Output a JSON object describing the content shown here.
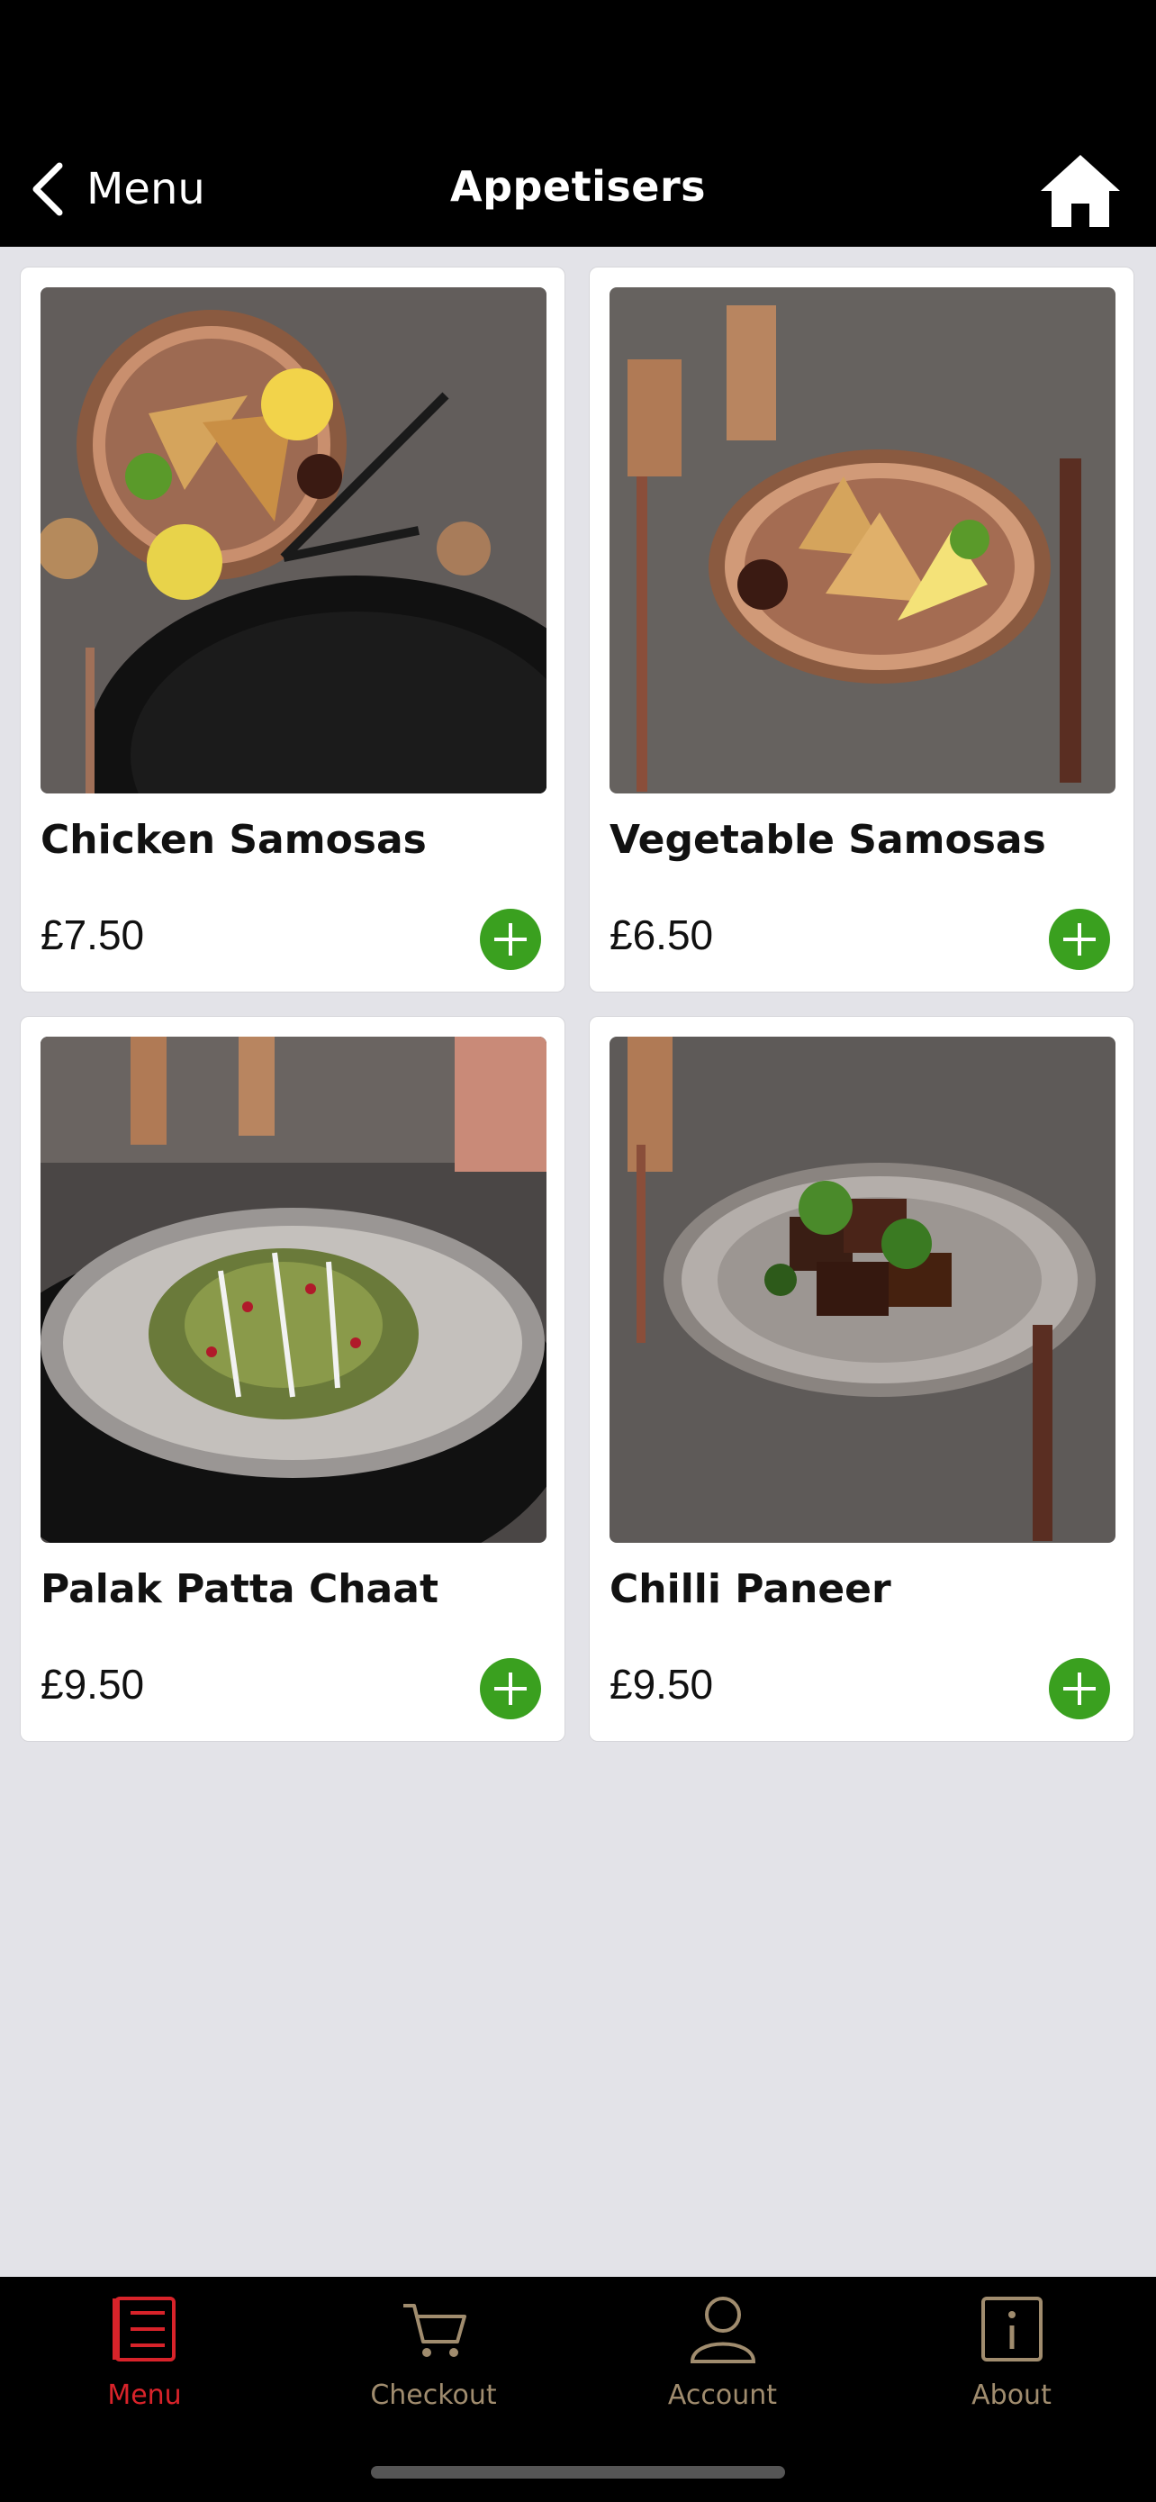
{
  "nav": {
    "back_label": "Menu",
    "title": "Appetisers"
  },
  "items": [
    {
      "name": "Chicken Samosas",
      "price": "£7.50"
    },
    {
      "name": "Vegetable Samosas",
      "price": "£6.50"
    },
    {
      "name": "Palak Patta Chaat",
      "price": "£9.50"
    },
    {
      "name": "Chilli Paneer",
      "price": "£9.50"
    }
  ],
  "tabs": [
    {
      "label": "Menu",
      "icon": "menu-list-icon",
      "active": true
    },
    {
      "label": "Checkout",
      "icon": "cart-icon",
      "active": false
    },
    {
      "label": "Account",
      "icon": "user-icon",
      "active": false
    },
    {
      "label": "About",
      "icon": "info-icon",
      "active": false
    }
  ],
  "colors": {
    "add_button": "#3aa01f",
    "tab_active": "#d8232a",
    "tab_inactive": "#a08c6e",
    "bar_background": "#000000"
  }
}
